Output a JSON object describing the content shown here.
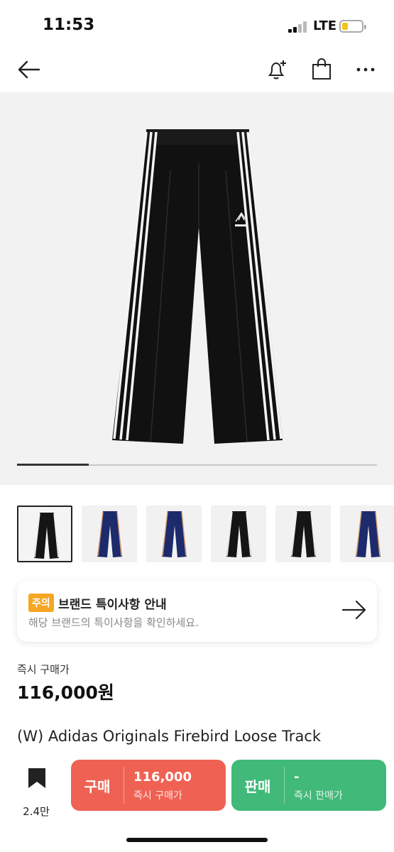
{
  "status_bar": {
    "time": "11:53",
    "network": "LTE"
  },
  "nav": {
    "back_icon": "arrow-left-icon",
    "icons": [
      "bell-plus-icon",
      "shopping-bag-icon",
      "more-icon"
    ]
  },
  "gallery": {
    "progress_fraction": 0.2,
    "thumbnail_colors": [
      "black",
      "navy",
      "navy",
      "black",
      "black",
      "navy"
    ],
    "selected_index": 0
  },
  "notice": {
    "tag": "주의",
    "title": "브랜드 특이사항 안내",
    "subtitle": "해당 브랜드의 특이사항을 확인하세요."
  },
  "price": {
    "label": "즉시 구매가",
    "value": "116,000원"
  },
  "product": {
    "name": "(W) Adidas Originals Firebird Loose Track"
  },
  "bottom_bar": {
    "wish_count": "2.4만",
    "buy": {
      "label": "구매",
      "value": "116,000",
      "sub": "즉시 구매가"
    },
    "sell": {
      "label": "판매",
      "value": "-",
      "sub": "즉시 판매가"
    }
  },
  "colors": {
    "buy": "#ef6253",
    "sell": "#41b979",
    "tag": "#f5a623"
  }
}
